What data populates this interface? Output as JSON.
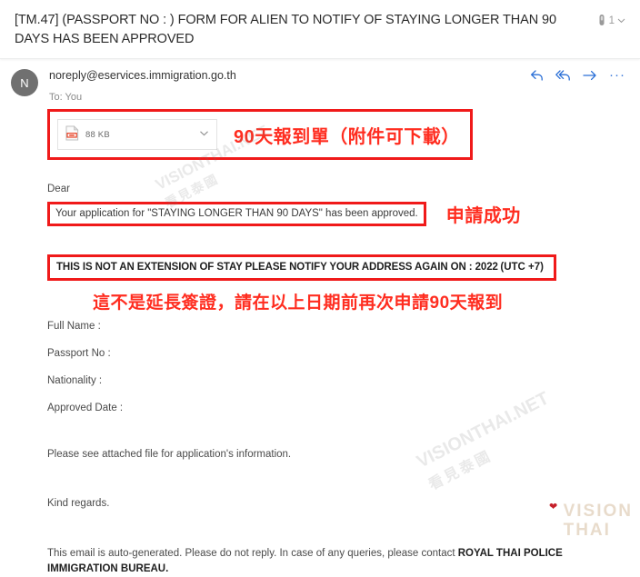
{
  "header": {
    "subject": "[TM.47] (PASSPORT NO :                  ) FORM FOR ALIEN TO NOTIFY OF STAYING LONGER THAN 90 DAYS HAS BEEN APPROVED",
    "attachment_count": "1",
    "attachment_icon": "paperclip-icon",
    "expand_icon": "chevron-down-icon"
  },
  "message": {
    "avatar_initial": "N",
    "sender_email": "noreply@eservices.immigration.go.th",
    "recipients": "To: You",
    "actions": [
      {
        "name": "reply-icon",
        "label": "Reply"
      },
      {
        "name": "reply-all-icon",
        "label": "Reply all"
      },
      {
        "name": "forward-icon",
        "label": "Forward"
      },
      {
        "name": "more-actions-icon",
        "label": "More actions"
      }
    ]
  },
  "attachment": {
    "file_icon": "pdf-file-icon",
    "size": "88 KB",
    "dropdown_icon": "chevron-down-icon",
    "annotation": "90天報到單（附件可下載）"
  },
  "body": {
    "greeting": "Dear",
    "approved_line": "Your application for \"STAYING LONGER THAN 90 DAYS\" has been approved.",
    "approved_annotation": "申請成功",
    "notify_line": "THIS IS NOT AN EXTENSION OF STAY PLEASE NOTIFY YOUR ADDRESS AGAIN ON : 2022",
    "notify_utc": "(UTC +7)",
    "notify_annotation": "這不是延長簽證，請在以上日期前再次申請90天報到",
    "fields": [
      "Full Name :",
      "Passport No :",
      "Nationality :",
      "Approved Date :"
    ],
    "attached_note": "Please see attached file for application's information.",
    "regards": "Kind regards.",
    "footer_prefix": "This email is auto-generated. Please do not reply. In case of any queries, please contact ",
    "footer_bold": "ROYAL THAI POLICE IMMIGRATION BUREAU."
  },
  "watermarks": {
    "latin": "VISIONTHAI.NET",
    "cjk": "看見泰國",
    "corner_line1": "VISION",
    "corner_line2": "THAI"
  },
  "colors": {
    "annotation_red": "#ff2d20",
    "box_red": "#f01a1a",
    "action_blue": "#2a6fd6",
    "avatar_grey": "#707070"
  }
}
